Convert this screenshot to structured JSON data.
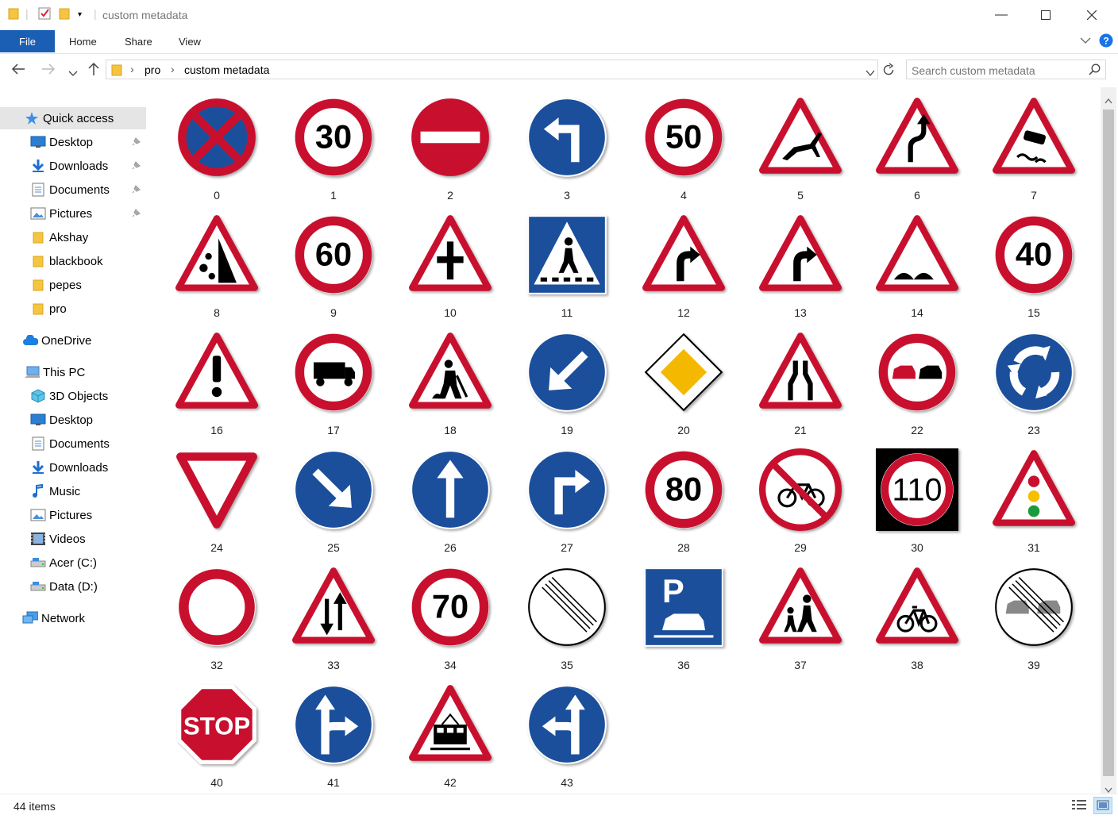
{
  "window": {
    "title": "custom metadata"
  },
  "ribbon": {
    "file": "File",
    "tabs": [
      "Home",
      "Share",
      "View"
    ]
  },
  "address": {
    "segments": [
      "pro",
      "custom metadata"
    ]
  },
  "search": {
    "placeholder": "Search custom metadata"
  },
  "sidebar": {
    "quick_access": "Quick access",
    "items": [
      {
        "label": "Desktop",
        "icon": "desktop-icon",
        "pinned": true
      },
      {
        "label": "Downloads",
        "icon": "download-icon",
        "pinned": true
      },
      {
        "label": "Documents",
        "icon": "document-icon",
        "pinned": true
      },
      {
        "label": "Pictures",
        "icon": "pictures-icon",
        "pinned": true
      },
      {
        "label": "Akshay",
        "icon": "folder-icon",
        "pinned": false
      },
      {
        "label": "blackbook",
        "icon": "folder-icon",
        "pinned": false
      },
      {
        "label": "pepes",
        "icon": "folder-icon",
        "pinned": false
      },
      {
        "label": "pro",
        "icon": "folder-icon",
        "pinned": false
      }
    ],
    "onedrive": "OneDrive",
    "this_pc": "This PC",
    "pc_items": [
      {
        "label": "3D Objects",
        "icon": "cube-icon"
      },
      {
        "label": "Desktop",
        "icon": "desktop-icon"
      },
      {
        "label": "Documents",
        "icon": "document-icon"
      },
      {
        "label": "Downloads",
        "icon": "download-icon"
      },
      {
        "label": "Music",
        "icon": "music-icon"
      },
      {
        "label": "Pictures",
        "icon": "pictures-icon"
      },
      {
        "label": "Videos",
        "icon": "video-icon"
      },
      {
        "label": "Acer (C:)",
        "icon": "drive-icon"
      },
      {
        "label": "Data (D:)",
        "icon": "drive-icon"
      }
    ],
    "network": "Network"
  },
  "files": [
    {
      "name": "0",
      "sign": "no-stopping"
    },
    {
      "name": "1",
      "sign": "speed-limit",
      "text": "30"
    },
    {
      "name": "2",
      "sign": "no-entry"
    },
    {
      "name": "3",
      "sign": "turn-left-ahead"
    },
    {
      "name": "4",
      "sign": "speed-limit",
      "text": "50"
    },
    {
      "name": "5",
      "sign": "warning-deer"
    },
    {
      "name": "6",
      "sign": "warning-double-curve"
    },
    {
      "name": "7",
      "sign": "warning-slippery"
    },
    {
      "name": "8",
      "sign": "warning-falling-rocks"
    },
    {
      "name": "9",
      "sign": "speed-limit",
      "text": "60"
    },
    {
      "name": "10",
      "sign": "warning-crossroads"
    },
    {
      "name": "11",
      "sign": "pedestrian-crossing"
    },
    {
      "name": "12",
      "sign": "warning-curve-right"
    },
    {
      "name": "13",
      "sign": "warning-curve-right"
    },
    {
      "name": "14",
      "sign": "warning-bumps"
    },
    {
      "name": "15",
      "sign": "speed-limit",
      "text": "40"
    },
    {
      "name": "16",
      "sign": "warning-exclamation"
    },
    {
      "name": "17",
      "sign": "no-trucks"
    },
    {
      "name": "18",
      "sign": "warning-roadworks"
    },
    {
      "name": "19",
      "sign": "keep-left"
    },
    {
      "name": "20",
      "sign": "priority-road"
    },
    {
      "name": "21",
      "sign": "warning-road-narrows"
    },
    {
      "name": "22",
      "sign": "no-overtaking"
    },
    {
      "name": "23",
      "sign": "roundabout"
    },
    {
      "name": "24",
      "sign": "yield"
    },
    {
      "name": "25",
      "sign": "keep-right"
    },
    {
      "name": "26",
      "sign": "ahead-only"
    },
    {
      "name": "27",
      "sign": "turn-right-ahead"
    },
    {
      "name": "28",
      "sign": "speed-limit",
      "text": "80"
    },
    {
      "name": "29",
      "sign": "no-bicycles"
    },
    {
      "name": "30",
      "sign": "speed-limit-black",
      "text": "110"
    },
    {
      "name": "31",
      "sign": "warning-traffic-lights"
    },
    {
      "name": "32",
      "sign": "no-vehicles"
    },
    {
      "name": "33",
      "sign": "warning-two-way"
    },
    {
      "name": "34",
      "sign": "speed-limit",
      "text": "70"
    },
    {
      "name": "35",
      "sign": "end-restrictions"
    },
    {
      "name": "36",
      "sign": "parking"
    },
    {
      "name": "37",
      "sign": "warning-children"
    },
    {
      "name": "38",
      "sign": "warning-bicycles"
    },
    {
      "name": "39",
      "sign": "end-no-overtaking"
    },
    {
      "name": "40",
      "sign": "stop",
      "text": "STOP"
    },
    {
      "name": "41",
      "sign": "straight-or-right"
    },
    {
      "name": "42",
      "sign": "warning-train"
    },
    {
      "name": "43",
      "sign": "straight-or-left"
    }
  ],
  "status": {
    "count": "44 items"
  },
  "colors": {
    "red": "#c8102e",
    "blue": "#1b4f9c",
    "selection": "#cce8ff",
    "file_tab": "#1a5fb4"
  }
}
